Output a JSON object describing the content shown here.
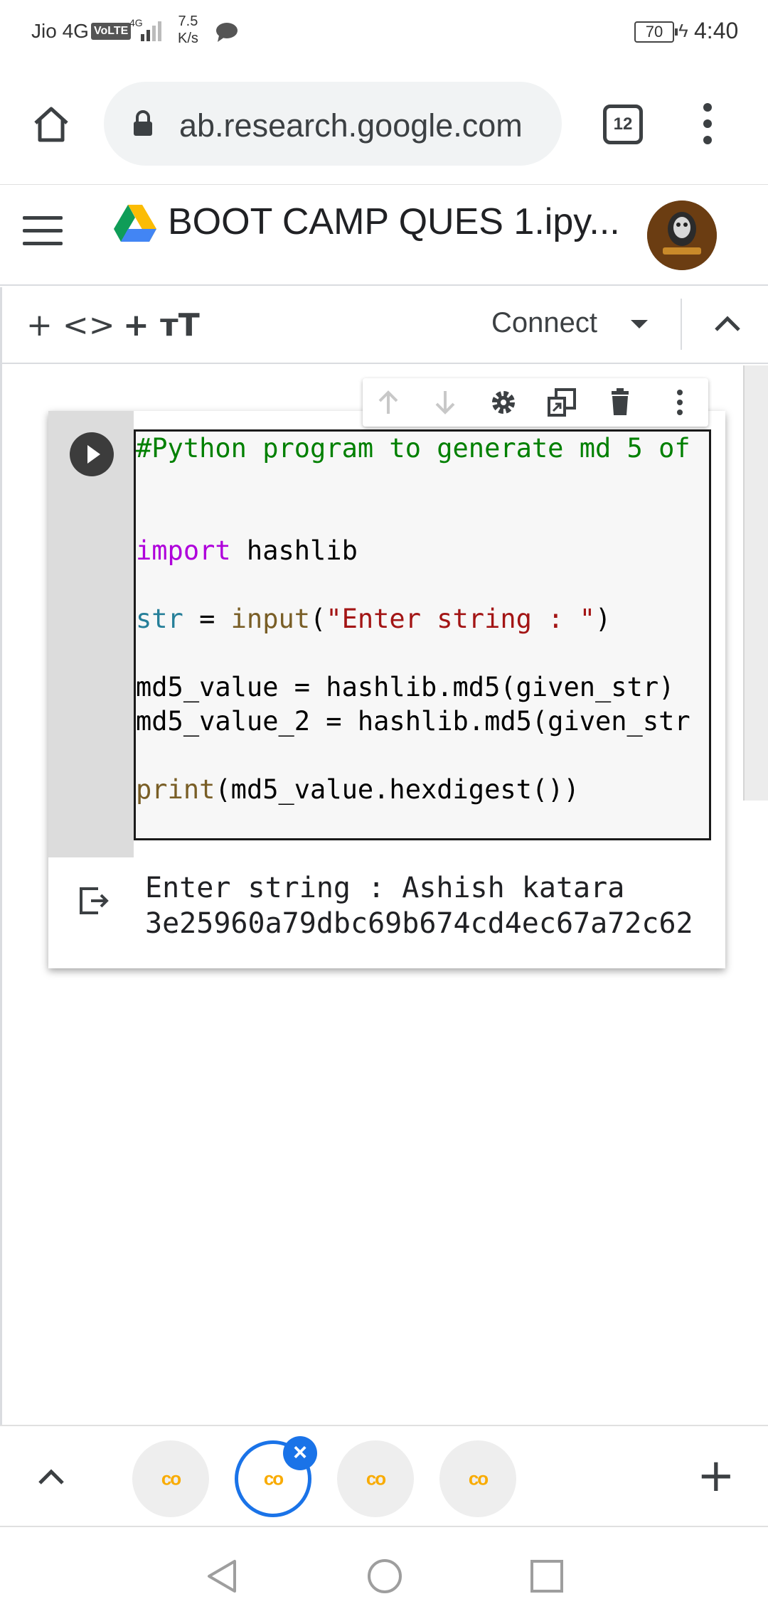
{
  "status_bar": {
    "carrier": "Jio 4G",
    "volte": "VoLTE",
    "network": "4G",
    "speed_value": "7.5",
    "speed_unit": "K/s",
    "battery": "70",
    "time": "4:40"
  },
  "browser": {
    "url": "ab.research.google.com",
    "tab_count": "12"
  },
  "colab": {
    "notebook_title": "BOOT CAMP QUES 1.ipy...",
    "toolbar": {
      "add_code": "+ <>",
      "add_text": "+ тT",
      "connect": "Connect"
    }
  },
  "cell": {
    "code_lines": [
      {
        "parts": [
          {
            "cls": "c-comment",
            "text": "#Python program to generate md 5 of"
          }
        ]
      },
      {
        "parts": []
      },
      {
        "parts": []
      },
      {
        "parts": [
          {
            "cls": "c-kw",
            "text": "import"
          },
          {
            "cls": "c-plain",
            "text": " hashlib"
          }
        ]
      },
      {
        "parts": []
      },
      {
        "parts": [
          {
            "cls": "c-var",
            "text": "str"
          },
          {
            "cls": "c-plain",
            "text": " = "
          },
          {
            "cls": "c-fn",
            "text": "input"
          },
          {
            "cls": "c-plain",
            "text": "("
          },
          {
            "cls": "c-str",
            "text": "\"Enter string : \""
          },
          {
            "cls": "c-plain",
            "text": ")"
          }
        ]
      },
      {
        "parts": []
      },
      {
        "parts": [
          {
            "cls": "c-plain",
            "text": "md5_value = hashlib.md5(given_str)"
          }
        ]
      },
      {
        "parts": [
          {
            "cls": "c-plain",
            "text": "md5_value_2 = hashlib.md5(given_str"
          }
        ]
      },
      {
        "parts": []
      },
      {
        "parts": [
          {
            "cls": "c-fn",
            "text": "print"
          },
          {
            "cls": "c-plain",
            "text": "(md5_value.hexdigest())"
          }
        ]
      }
    ],
    "output_lines": [
      "Enter string : Ashish katara",
      "3e25960a79dbc69b674cd4ec67a72c62"
    ]
  },
  "tab_strip": {
    "tabs": [
      {
        "label": "co",
        "active": false
      },
      {
        "label": "co",
        "active": true
      },
      {
        "label": "co",
        "active": false
      },
      {
        "label": "co",
        "active": false
      }
    ],
    "close_label": "×",
    "new_tab_label": "+"
  }
}
